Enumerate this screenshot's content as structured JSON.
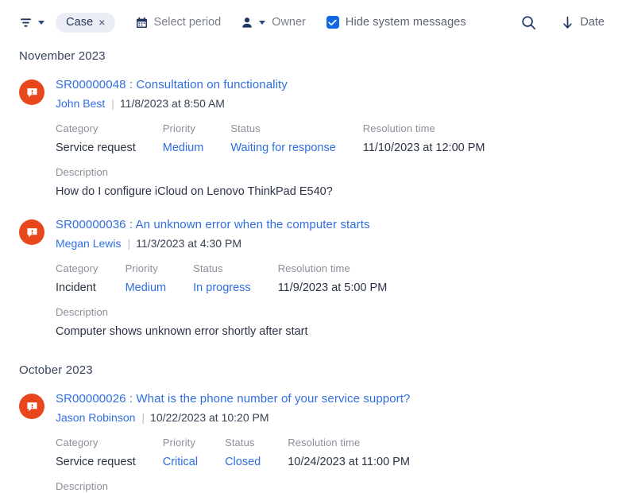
{
  "toolbar": {
    "filter_icon": "filter-icon",
    "filter_caret": "chevron-down-icon",
    "chip": {
      "label": "Case",
      "remove": "×"
    },
    "period": {
      "icon": "calendar-icon",
      "label": "Select period"
    },
    "owner": {
      "icon": "person-icon",
      "caret": "chevron-down-icon",
      "label": "Owner"
    },
    "hide_system": {
      "label": "Hide system messages",
      "checked": true
    },
    "search": {
      "icon": "search-icon"
    },
    "sort": {
      "icon": "arrow-down-icon",
      "label": "Date"
    },
    "accent_blue": "#1068e0",
    "chip_bg": "#eceef6",
    "icon_navy": "#1f3864"
  },
  "feed": {
    "groups": [
      {
        "month": "November 2023",
        "cases": [
          {
            "avatar_icon": "case-speech-bubble-icon",
            "avatar_color": "#e8461c",
            "title": "SR00000048 : Consultation on functionality",
            "author": "John Best",
            "separator": "|",
            "date": "11/8/2023 at 8:50 AM",
            "fields": [
              {
                "label": "Category",
                "value": "Service request",
                "link": false
              },
              {
                "label": "Priority",
                "value": "Medium",
                "link": true
              },
              {
                "label": "Status",
                "value": "Waiting for response",
                "link": true
              },
              {
                "label": "Resolution time",
                "value": "11/10/2023 at 12:00 PM",
                "link": false
              }
            ],
            "description_label": "Description",
            "description": "How do I configure iCloud on Lenovo ThinkPad E540?"
          },
          {
            "avatar_icon": "case-speech-bubble-icon",
            "avatar_color": "#e8461c",
            "title": "SR00000036 : An unknown error when the computer starts",
            "author": "Megan Lewis",
            "separator": "|",
            "date": "11/3/2023 at 4:30 PM",
            "fields": [
              {
                "label": "Category",
                "value": "Incident",
                "link": false
              },
              {
                "label": "Priority",
                "value": "Medium",
                "link": true
              },
              {
                "label": "Status",
                "value": "In progress",
                "link": true
              },
              {
                "label": "Resolution time",
                "value": "11/9/2023 at 5:00 PM",
                "link": false
              }
            ],
            "description_label": "Description",
            "description": "Computer shows unknown error shortly after start"
          }
        ]
      },
      {
        "month": "October 2023",
        "cases": [
          {
            "avatar_icon": "case-speech-bubble-icon",
            "avatar_color": "#e8461c",
            "title": "SR00000026 : What is the phone number of your service support?",
            "author": "Jason Robinson",
            "separator": "|",
            "date": "10/22/2023 at 10:20 PM",
            "fields": [
              {
                "label": "Category",
                "value": "Service request",
                "link": false
              },
              {
                "label": "Priority",
                "value": "Critical",
                "link": true
              },
              {
                "label": "Status",
                "value": "Closed",
                "link": true
              },
              {
                "label": "Resolution time",
                "value": "10/24/2023 at 11:00 PM",
                "link": false
              }
            ],
            "description_label": "Description",
            "description": ""
          }
        ]
      }
    ]
  }
}
